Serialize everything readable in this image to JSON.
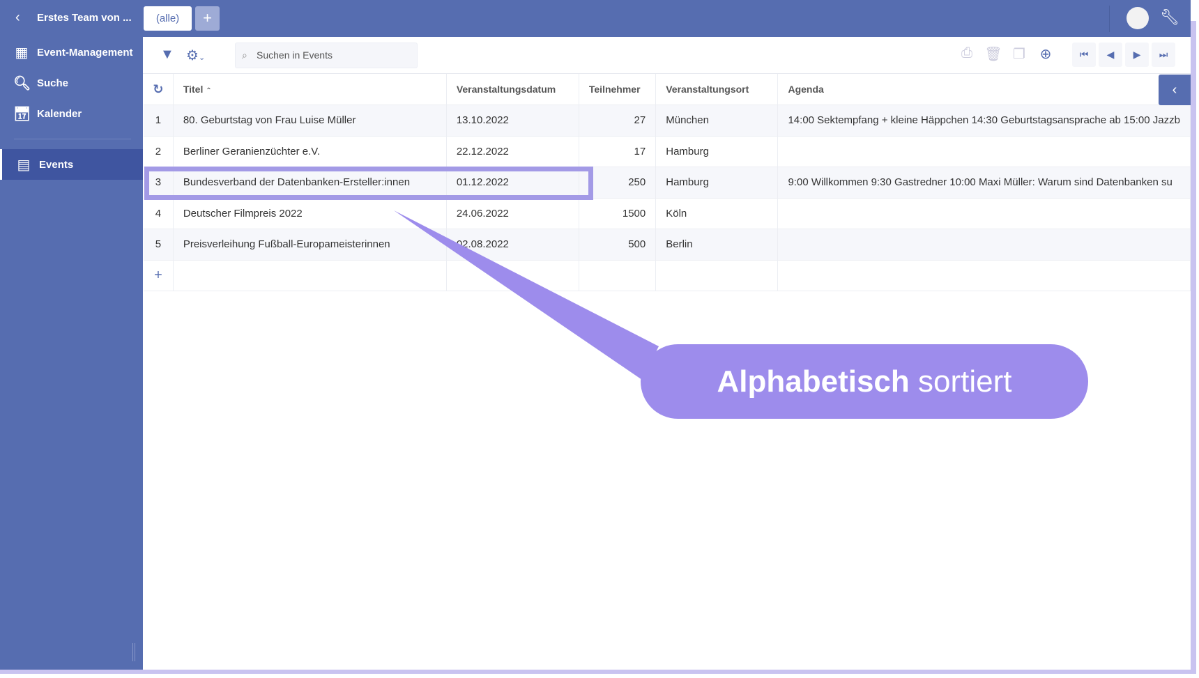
{
  "topbar": {
    "team": "Erstes Team von ...",
    "tab_all": "(alle)",
    "tab_add": "+"
  },
  "sidebar": {
    "items": [
      {
        "label": "Event-Management"
      },
      {
        "label": "Suche"
      },
      {
        "label": "Kalender"
      },
      {
        "label": "Events"
      }
    ]
  },
  "toolbar": {
    "search_placeholder": "Suchen in Events"
  },
  "table": {
    "headers": [
      "Titel",
      "Veranstaltungsdatum",
      "Teilnehmer",
      "Veranstaltungsort",
      "Agenda"
    ],
    "rows": [
      {
        "n": "1",
        "titel": "80. Geburtstag von Frau Luise Müller",
        "datum": "13.10.2022",
        "teilnehmer": "27",
        "ort": "München",
        "agenda": "14:00 Sektempfang + kleine Häppchen 14:30 Geburtstagsansprache ab 15:00 Jazzb"
      },
      {
        "n": "2",
        "titel": "Berliner Geranienzüchter e.V.",
        "datum": "22.12.2022",
        "teilnehmer": "17",
        "ort": "Hamburg",
        "agenda": ""
      },
      {
        "n": "3",
        "titel": "Bundesverband der Datenbanken-Ersteller:innen",
        "datum": "01.12.2022",
        "teilnehmer": "250",
        "ort": "Hamburg",
        "agenda": "9:00 Willkommen 9:30 Gastredner 10:00 Maxi Müller: Warum sind Datenbanken su"
      },
      {
        "n": "4",
        "titel": "Deutscher Filmpreis 2022",
        "datum": "24.06.2022",
        "teilnehmer": "1500",
        "ort": "Köln",
        "agenda": ""
      },
      {
        "n": "5",
        "titel": "Preisverleihung Fußball-Europameisterinnen",
        "datum": "02.08.2022",
        "teilnehmer": "500",
        "ort": "Berlin",
        "agenda": ""
      }
    ],
    "add_row": "+"
  },
  "callout": {
    "bold": "Alphabetisch",
    "rest": " sortiert"
  },
  "colors": {
    "primary": "#566db0",
    "callout": "#9d8cec"
  }
}
